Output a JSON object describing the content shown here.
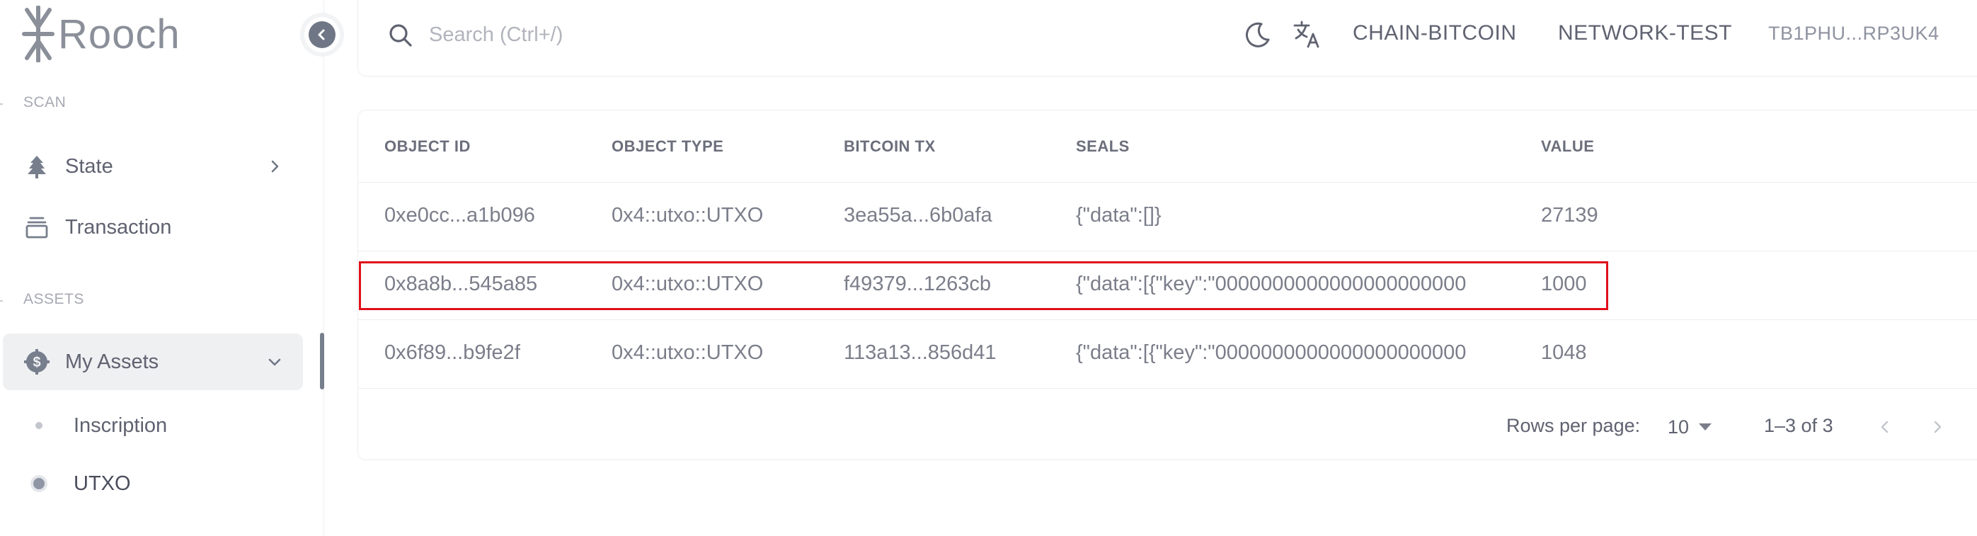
{
  "brand": {
    "name": "Rooch"
  },
  "sidebar": {
    "sections": [
      {
        "label": "SCAN"
      },
      {
        "label": "ASSETS"
      }
    ],
    "items": [
      {
        "label": "State",
        "icon": "tree-icon"
      },
      {
        "label": "Transaction",
        "icon": "layers-icon"
      },
      {
        "label": "My Assets",
        "icon": "dollar-gear-icon"
      }
    ],
    "sub_items": [
      {
        "label": "Inscription"
      },
      {
        "label": "UTXO"
      }
    ]
  },
  "topbar": {
    "search_placeholder": "Search (Ctrl+/)",
    "chain": "CHAIN-BITCOIN",
    "network": "NETWORK-TEST",
    "address": "TB1PHU...RP3UK4"
  },
  "table": {
    "columns": [
      "OBJECT ID",
      "OBJECT TYPE",
      "BITCOIN TX",
      "SEALS",
      "VALUE"
    ],
    "rows": [
      {
        "object_id": "0xe0cc...a1b096",
        "object_type": "0x4::utxo::UTXO",
        "bitcoin_tx": "3ea55a...6b0afa",
        "seals": "{\"data\":[]}",
        "value": "27139"
      },
      {
        "object_id": "0x8a8b...545a85",
        "object_type": "0x4::utxo::UTXO",
        "bitcoin_tx": "f49379...1263cb",
        "seals": "{\"data\":[{\"key\":\"0000000000000000000000",
        "value": "1000"
      },
      {
        "object_id": "0x6f89...b9fe2f",
        "object_type": "0x4::utxo::UTXO",
        "bitcoin_tx": "113a13...856d41",
        "seals": "{\"data\":[{\"key\":\"0000000000000000000000",
        "value": "1048"
      }
    ]
  },
  "pagination": {
    "rows_per_page_label": "Rows per page:",
    "rows_per_page": "10",
    "range": "1–3 of 3"
  },
  "colors": {
    "highlight": "#e0101a",
    "accent": "#6f7686"
  }
}
